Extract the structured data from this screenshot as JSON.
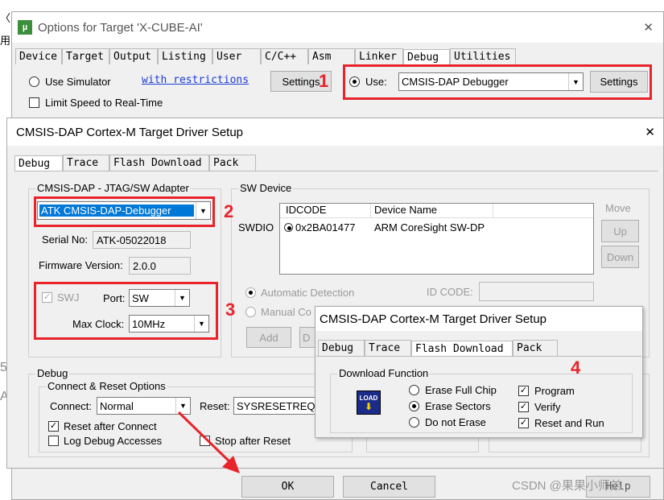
{
  "options_window": {
    "title": "Options for Target 'X-CUBE-AI'",
    "close": "✕",
    "tabs": [
      "Device",
      "Target",
      "Output",
      "Listing",
      "User",
      "C/C++",
      "Asm",
      "Linker",
      "Debug",
      "Utilities"
    ],
    "active_tab": "Debug",
    "use_simulator": "Use Simulator",
    "restrictions_link": "with restrictions",
    "settings_left": "Settings",
    "limit_speed": "Limit Speed to Real-Time",
    "use_label": "Use:",
    "debugger": "CMSIS-DAP Debugger",
    "settings_right": "Settings",
    "ok": "OK",
    "cancel": "Cancel",
    "help": "Help"
  },
  "driver_setup": {
    "title": "CMSIS-DAP Cortex-M Target Driver Setup",
    "close": "✕",
    "tabs": [
      "Debug",
      "Trace",
      "Flash Download",
      "Pack"
    ],
    "adapter_group": "CMSIS-DAP - JTAG/SW Adapter",
    "adapter": "ATK CMSIS-DAP-Debugger",
    "serial_label": "Serial No:",
    "serial": "ATK-05022018",
    "firmware_label": "Firmware Version:",
    "firmware": "2.0.0",
    "swj": "SWJ",
    "port_label": "Port:",
    "port": "SW",
    "maxclock_label": "Max Clock:",
    "maxclock": "10MHz",
    "swdevice_group": "SW Device",
    "swdio": "SWDIO",
    "idcode_header": "IDCODE",
    "devname_header": "Device Name",
    "idcode": "0x2BA01477",
    "devname": "ARM CoreSight SW-DP",
    "move": "Move",
    "up": "Up",
    "down": "Down",
    "auto_detect": "Automatic Detection",
    "manual": "Manual Co",
    "id_code_label": "ID CODE:",
    "add": "Add",
    "del": "D",
    "debug_group": "Debug",
    "connect_reset_group": "Connect & Reset Options",
    "connect_label": "Connect:",
    "connect": "Normal",
    "reset_label": "Reset:",
    "reset": "SYSRESETREQ",
    "reset_after_connect": "Reset after Connect",
    "log_debug": "Log Debug Accesses",
    "stop_after_reset": "Stop after Reset"
  },
  "flash_setup": {
    "title": "CMSIS-DAP Cortex-M Target Driver Setup",
    "tabs": [
      "Debug",
      "Trace",
      "Flash Download",
      "Pack"
    ],
    "group": "Download Function",
    "load_icon_text": "LOAD",
    "erase_full": "Erase Full Chip",
    "erase_sectors": "Erase Sectors",
    "no_erase": "Do not Erase",
    "program": "Program",
    "verify": "Verify",
    "reset_run": "Reset and Run"
  },
  "annotations": {
    "n1": "1",
    "n2": "2",
    "n3": "3",
    "n4": "4"
  },
  "side_text": {
    "chinese": "用",
    "five": "5",
    "a": "A"
  },
  "watermark": "CSDN @果果小师弟",
  "colors": {
    "annotation_red": "#e8232a",
    "selection_blue": "#0078d7"
  }
}
